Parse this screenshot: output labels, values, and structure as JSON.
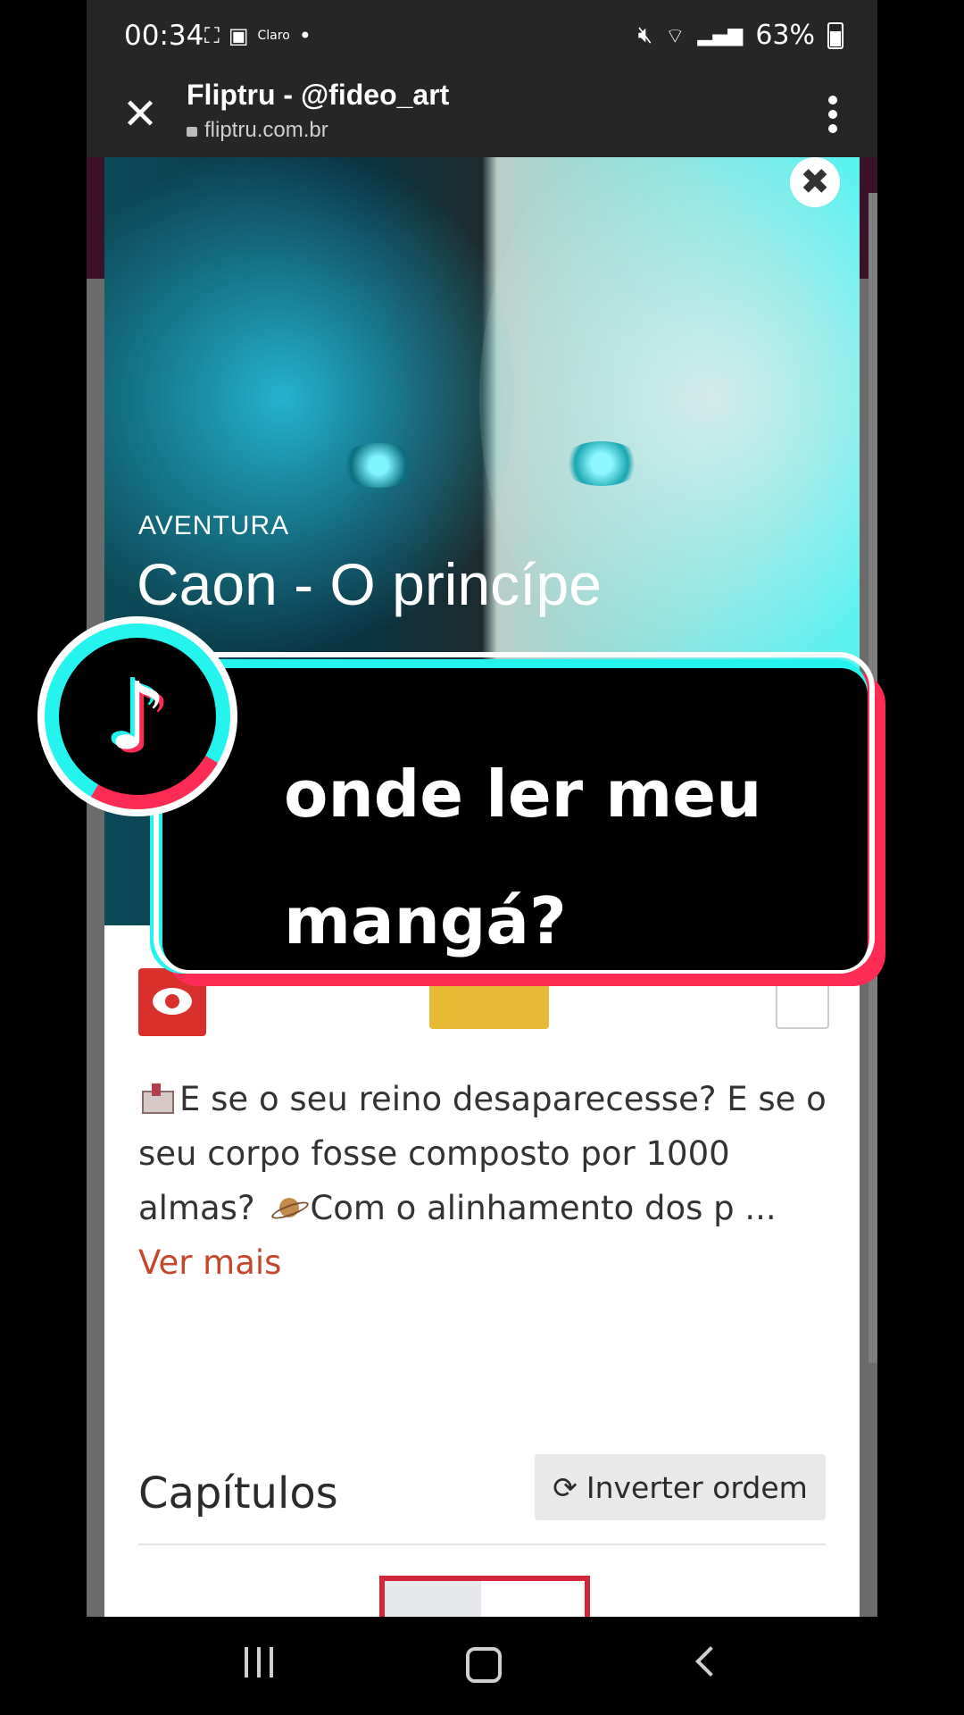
{
  "status_bar": {
    "time": "00:34",
    "carrier": "Claro",
    "battery": "63%"
  },
  "browser": {
    "title": "Fliptru - @fideo_art",
    "url": "fliptru.com.br",
    "close_symbol": "✕",
    "modal_close_symbol": "✖"
  },
  "manga": {
    "genre": "AVENTURA",
    "title": "Caon - O princípe",
    "description_part1": "E se o seu reino desaparecesse? E se o seu corpo fosse composto por 1000 almas?",
    "description_part2": "Com o alinhamento dos p ...",
    "see_more": "Ver mais"
  },
  "chapters": {
    "heading": "Capítulos",
    "invert_label": "Inverter ordem",
    "invert_icon": "⟳"
  },
  "overlay": {
    "caption": "onde ler meu mangá?",
    "logo_glyph": "♪"
  }
}
